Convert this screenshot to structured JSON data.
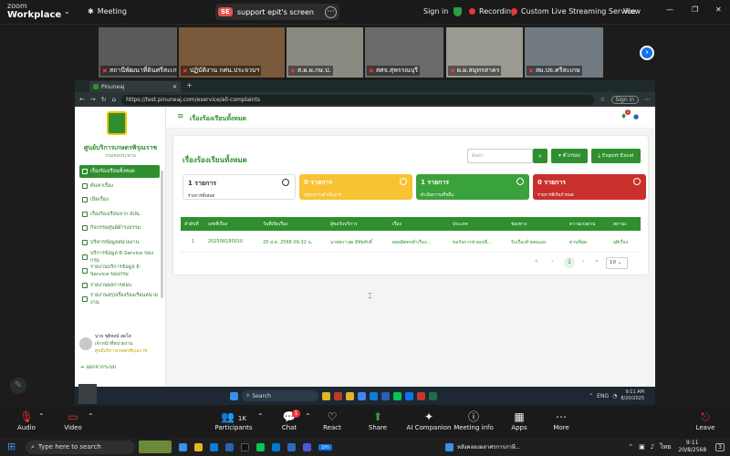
{
  "zoom": {
    "logo_line1": "zoom",
    "logo_line2": "Workplace",
    "meeting_label": "Meeting",
    "share_badge": "SE",
    "share_title": "support epit's screen",
    "sign_in": "Sign in",
    "recording": "Recording",
    "custom_stream": "Custom Live Streaming Service",
    "view": "View"
  },
  "participants": [
    {
      "name": "สถานีพัฒนาที่ดินศรีสะเกษ",
      "color": "#5a5a5a"
    },
    {
      "name": "ปฏิบัติงาน กศน.ประจวบฯ",
      "color": "#7a5a3a"
    },
    {
      "name": "ส.ผ.ผ.กษ.ป.",
      "color": "#8a8a80"
    },
    {
      "name": "สศจ.สุพรรณบุรี",
      "color": "#6a6a6a"
    },
    {
      "name": "ผ.ผ.สมุทรสาคร",
      "color": "#9a9a90"
    },
    {
      "name": "สผ.ปจ.ศรีสะเกษ",
      "color": "#707a80"
    }
  ],
  "browser": {
    "tab_title": "Pinuneaj",
    "url": "https://test.pinuneaj.com/eservice/all-complaints",
    "sign_in": "Sign in"
  },
  "app": {
    "org_name": "ศูนย์บริการเกษตรพิรุณราช",
    "org_sub": "กรมชลประทาน",
    "header_title": "เรื่องร้องเรียนทั้งหมด",
    "notif_count": "1",
    "nav": [
      {
        "label": "เรื่องร้องเรียนทั้งหมด",
        "active": true
      },
      {
        "label": "ค้นหาเรื่อง",
        "active": false
      },
      {
        "label": "เปิดเรื่อง",
        "active": false
      },
      {
        "label": "เรื่องร้องเรียนจาก สปน.",
        "active": false
      },
      {
        "label": "กิจกรรมศูนย์ดำรงธรรม",
        "active": false
      },
      {
        "label": "บริหารข้อมูลหน่วยงาน",
        "active": false
      },
      {
        "label": "บริการข้อมูล E-Service ของกรม",
        "active": false
      },
      {
        "label": "รายงานบริการข้อมูล E-Service ของกรม",
        "active": false
      },
      {
        "label": "รายงานผลการตอบ",
        "active": false
      },
      {
        "label": "รายงานสรุปเรื่องร้องเรียนหน่วยงาน",
        "active": false
      }
    ],
    "user_name": "นาย ชุติพงษ์ สดใส",
    "user_role": "เจ้าหน้าที่หน่วยงาน",
    "user_org": "ศูนย์บริการเกษตรพิรุณราช",
    "logout": "ออกจากระบบ",
    "page_title": "เรื่องร้องเรียนทั้งหมด",
    "search_placeholder": "ค้นหา",
    "filter_label": "ตัวกรอง",
    "export_label": "Export Excel",
    "stats": [
      {
        "count": "1 รายการ",
        "label": "รายการทั้งหมด",
        "bg": "#ffffff",
        "fg": "#333333"
      },
      {
        "count": "0 รายการ",
        "label": "อยู่ระหว่างดำเนินการ",
        "bg": "#f9c233",
        "fg": "#ffffff"
      },
      {
        "count": "1 รายการ",
        "label": "ดำเนินการเสร็จสิ้น",
        "bg": "#3aa23a",
        "fg": "#ffffff"
      },
      {
        "count": "0 รายการ",
        "label": "รายการที่เกินกำหนด",
        "bg": "#c9302c",
        "fg": "#ffffff"
      }
    ],
    "columns": [
      "ลำดับที่",
      "เลขที่เรื่อง",
      "วันที่เปิดเรื่อง",
      "ผู้ขอรับบริการ",
      "เรื่อง",
      "ประเภท",
      "ช่องทาง",
      "ความเร่งด่วน",
      "สถานะ"
    ],
    "rows": [
      [
        "1",
        "202508180010",
        "20 ส.ค. 2568 09:32 น.",
        "นายพราวุฒ มีชัยศักดิ์",
        "ผลผลิตตกต่ำเรื่อง...",
        "ขอรับการช่วยเหลื...",
        "รับเรื่องด้วยตนเอง",
        "ด่วนที่สุด",
        "ยุติเรื่อง"
      ]
    ],
    "pager_current": "1",
    "page_size": "10"
  },
  "inner_taskbar": {
    "search": "Search",
    "lang": "ENG",
    "time": "9:11 AM",
    "date": "8/20/2025"
  },
  "zoom_toolbar": {
    "audio": "Audio",
    "video": "Video",
    "participants": "Participants",
    "participants_count": "1K",
    "chat": "Chat",
    "chat_badge": "1",
    "react": "React",
    "share": "Share",
    "ai": "AI Companion",
    "info": "Meeting info",
    "apps": "Apps",
    "more": "More",
    "leave": "Leave"
  },
  "win_taskbar": {
    "search": "Type here to search",
    "active_app": "หลังคลองผลาศรการภาษี...",
    "lang": "ไทย",
    "time": "9:11",
    "date": "20/8/2568",
    "notif": "3"
  }
}
